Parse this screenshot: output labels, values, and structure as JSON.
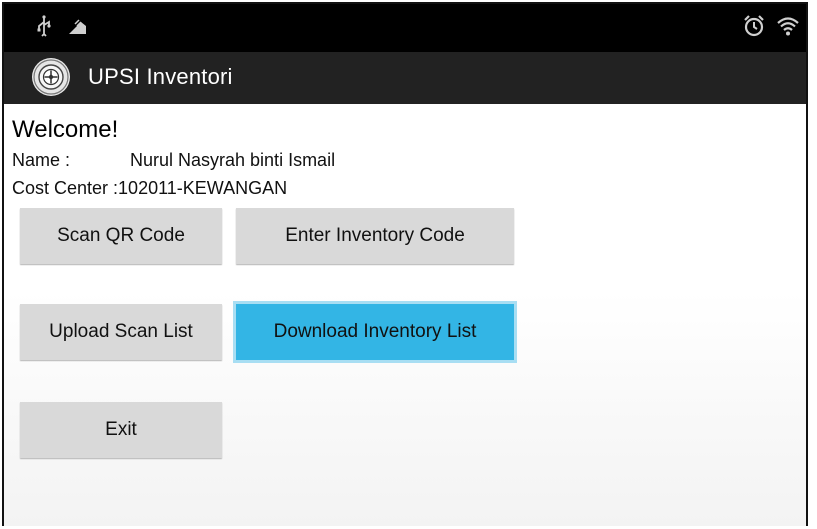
{
  "status_bar": {
    "left_icons": [
      "usb-icon",
      "debug-icon"
    ],
    "right_icons": [
      "alarm-icon",
      "wifi-icon"
    ]
  },
  "action_bar": {
    "app_title": "UPSI Inventori",
    "logo_icon": "upsi-logo-icon"
  },
  "main": {
    "welcome": "Welcome!",
    "name_label": "Name :",
    "name_value": "Nurul Nasyrah binti Ismail",
    "cost_center_label": "Cost Center :",
    "cost_center_value": "102011-KEWANGAN"
  },
  "buttons": {
    "scan_qr": "Scan QR Code",
    "enter_code": "Enter Inventory Code",
    "upload_list": "Upload Scan List",
    "download_list": "Download Inventory List",
    "exit": "Exit"
  },
  "colors": {
    "accent": "#33b5e5",
    "button_gray": "#d9d9d9",
    "action_bar": "#222222",
    "status_bar": "#000000"
  }
}
